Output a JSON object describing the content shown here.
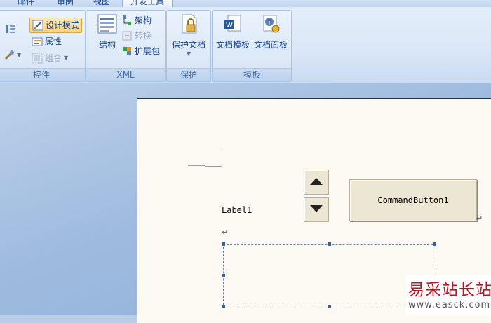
{
  "tabs": [
    {
      "label": "邮件"
    },
    {
      "label": "审阅"
    },
    {
      "label": "视图"
    },
    {
      "label": "开发工具"
    }
  ],
  "ribbon": {
    "groups": {
      "controls": {
        "label": "控件",
        "design_mode": "设计模式",
        "properties": "属性",
        "group": "组合"
      },
      "xml": {
        "label": "XML",
        "structure": "结构",
        "schema": "架构",
        "transform": "转换",
        "expansion_pack": "扩展包"
      },
      "protect": {
        "label": "保护",
        "protect_document": "保护文档"
      },
      "templates": {
        "label": "模板",
        "document_template": "文档模板",
        "document_panel": "文档面板"
      }
    }
  },
  "document": {
    "label_text": "Label1",
    "command_button_text": "CommandButton1"
  },
  "watermark": {
    "site_name": "易采站长站",
    "url": "www.easck.com"
  },
  "colors": {
    "ribbon_accent": "#15428b",
    "design_mode_highlight": "#fbd27a",
    "page_background": "#fcf9f3",
    "watermark_red": "#c1121f"
  }
}
